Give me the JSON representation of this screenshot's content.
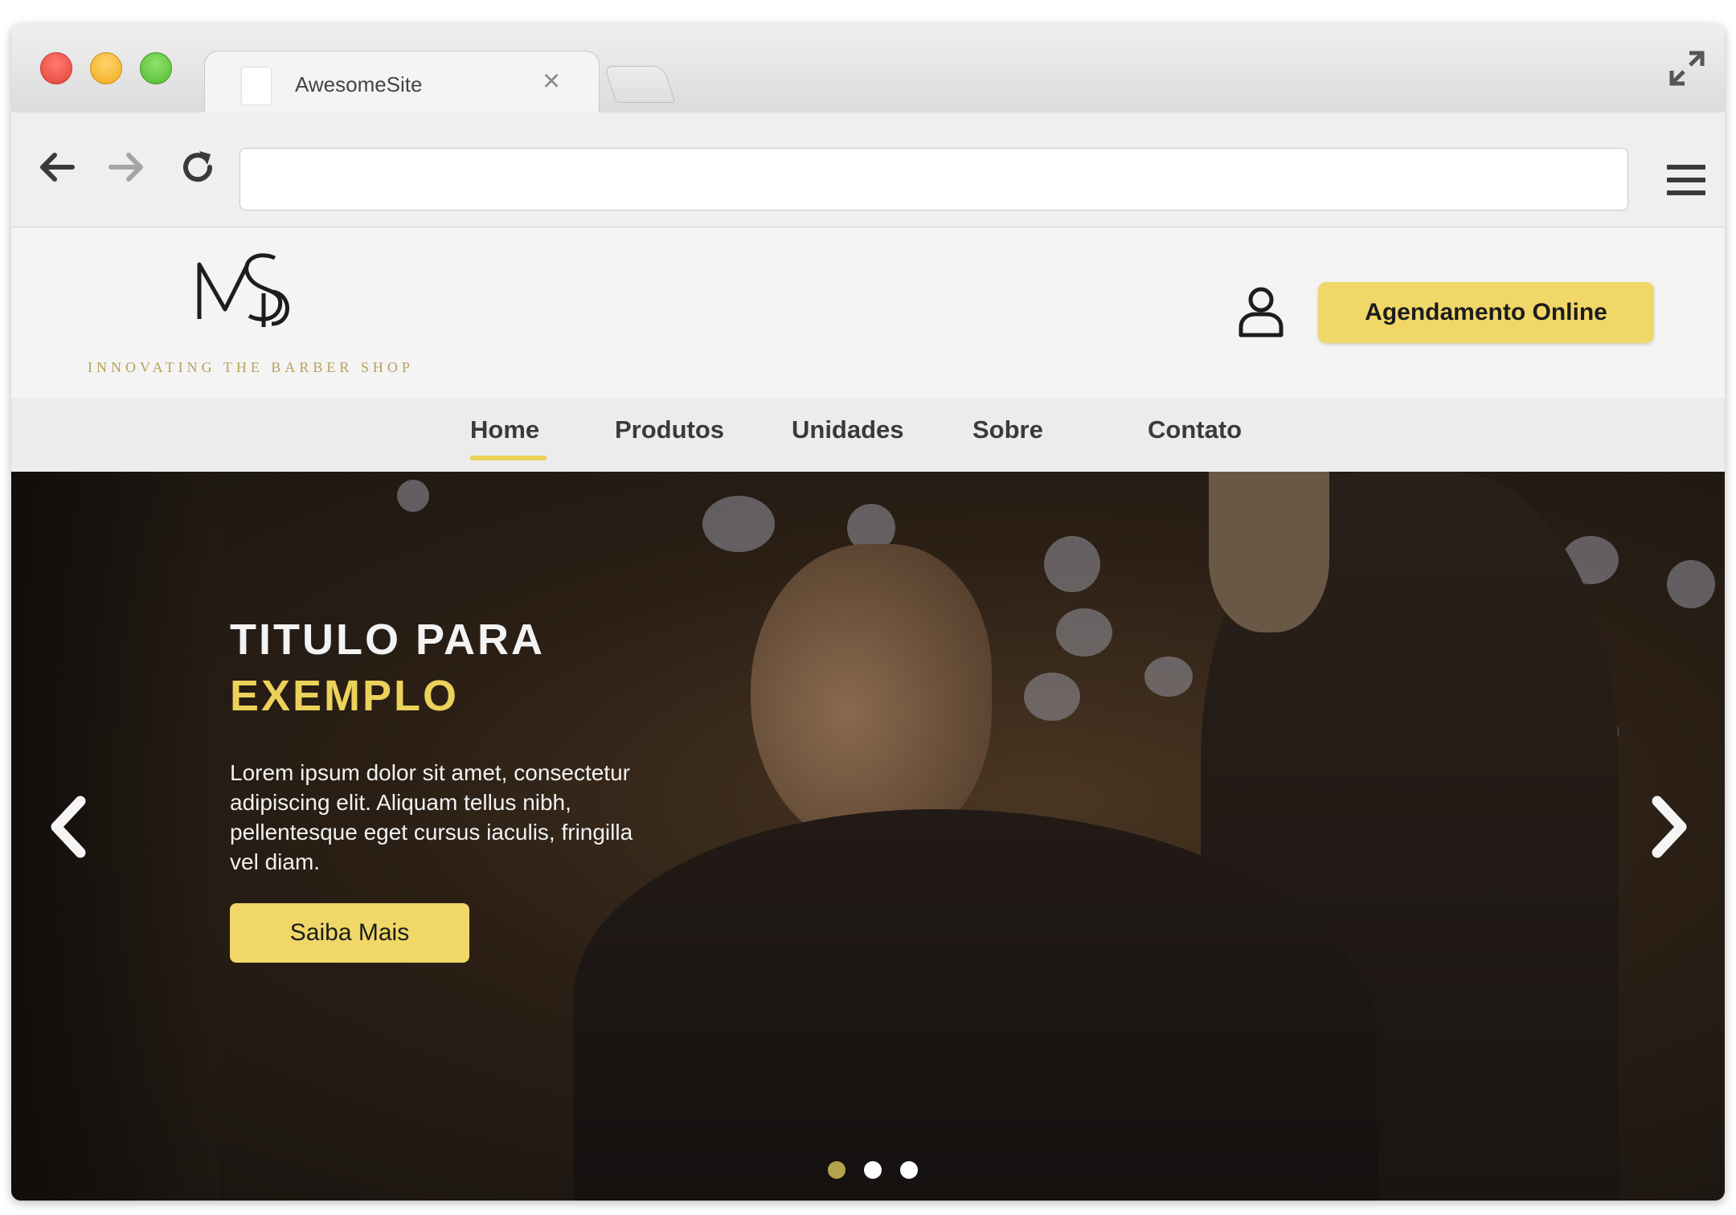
{
  "browser": {
    "tab_title": "AwesomeSite",
    "tab_close": "×",
    "address_value": ""
  },
  "header": {
    "tagline": "INNOVATING THE BARBER SHOP",
    "cta_label": "Agendamento Online"
  },
  "nav": {
    "items": [
      {
        "label": "Home",
        "active": true
      },
      {
        "label": "Produtos",
        "active": false
      },
      {
        "label": "Unidades",
        "active": false
      },
      {
        "label": "Sobre",
        "active": false
      },
      {
        "label": "Contato",
        "active": false
      }
    ]
  },
  "hero": {
    "title_line1": "TITULO PARA",
    "title_line2": "EXEMPLO",
    "body_lines": [
      "Lorem ipsum dolor sit amet, consectetur",
      "adipiscing elit. Aliquam tellus nibh,",
      "pellentesque eget cursus iaculis, fringilla",
      "vel diam."
    ],
    "button_label": "Saiba Mais",
    "slides_total": 3,
    "active_slide": 1
  },
  "colors": {
    "accent": "#f0d768",
    "dot_active": "#b5a24c",
    "dot_inactive": "#ffffff"
  },
  "icons": {
    "prev": "chevron-left-icon",
    "next": "chevron-right-icon",
    "user": "user-icon",
    "menu": "hamburger-menu-icon",
    "expand": "expand-icon"
  }
}
